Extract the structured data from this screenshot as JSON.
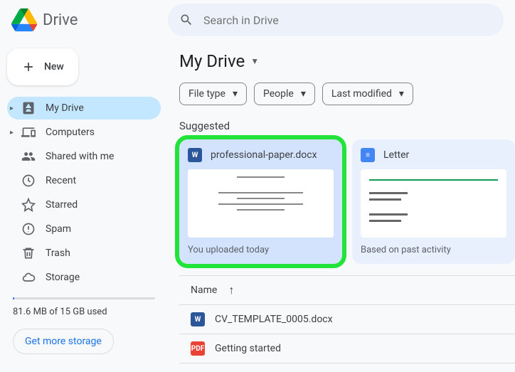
{
  "app": {
    "name": "Drive"
  },
  "search": {
    "placeholder": "Search in Drive"
  },
  "newButton": {
    "label": "New"
  },
  "sidebar": {
    "items": [
      {
        "label": "My Drive",
        "icon": "drive-icon",
        "expandable": true
      },
      {
        "label": "Computers",
        "icon": "devices-icon",
        "expandable": true
      },
      {
        "label": "Shared with me",
        "icon": "people-icon"
      },
      {
        "label": "Recent",
        "icon": "clock-icon"
      },
      {
        "label": "Starred",
        "icon": "star-icon"
      },
      {
        "label": "Spam",
        "icon": "spam-icon"
      },
      {
        "label": "Trash",
        "icon": "trash-icon"
      },
      {
        "label": "Storage",
        "icon": "cloud-icon"
      }
    ],
    "storageText": "81.6 MB of 15 GB used",
    "storageButton": "Get more storage"
  },
  "content": {
    "heading": "My Drive",
    "filters": [
      {
        "label": "File type"
      },
      {
        "label": "People"
      },
      {
        "label": "Last modified"
      }
    ],
    "suggestedLabel": "Suggested",
    "suggested": [
      {
        "title": "professional-paper.docx",
        "subtitle": "You uploaded today",
        "type": "word",
        "highlighted": true
      },
      {
        "title": "Letter",
        "subtitle": "Based on past activity",
        "type": "docs"
      }
    ],
    "listHeader": {
      "name": "Name"
    },
    "listRows": [
      {
        "name": "CV_TEMPLATE_0005.docx",
        "type": "word"
      },
      {
        "name": "Getting started",
        "type": "pdf"
      }
    ]
  }
}
